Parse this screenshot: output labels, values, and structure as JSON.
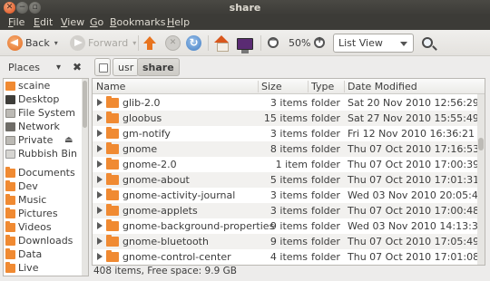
{
  "window": {
    "title": "share"
  },
  "menubar": {
    "items": [
      {
        "pre": "",
        "key": "F",
        "post": "ile"
      },
      {
        "pre": "",
        "key": "E",
        "post": "dit"
      },
      {
        "pre": "",
        "key": "V",
        "post": "iew"
      },
      {
        "pre": "",
        "key": "G",
        "post": "o"
      },
      {
        "pre": "",
        "key": "B",
        "post": "ookmarks"
      },
      {
        "pre": "",
        "key": "H",
        "post": "elp"
      }
    ]
  },
  "toolbar": {
    "back_label": "Back",
    "forward_label": "Forward",
    "zoom_level": "50%",
    "view_mode": "List View"
  },
  "location": {
    "places_label": "Places",
    "breadcrumbs": [
      "usr",
      "share"
    ]
  },
  "sidebar": {
    "items": [
      {
        "label": "scaine",
        "icon": "home-folder-icon",
        "kind": "home"
      },
      {
        "label": "Desktop",
        "icon": "desktop-icon",
        "kind": "desktop"
      },
      {
        "label": "File System",
        "icon": "drive-icon",
        "kind": "drive"
      },
      {
        "label": "Network",
        "icon": "network-icon",
        "kind": "network"
      },
      {
        "label": "Private",
        "icon": "drive-icon",
        "kind": "drive",
        "eject": true
      },
      {
        "label": "Rubbish Bin",
        "icon": "trash-icon",
        "kind": "trash"
      },
      {
        "label": "Documents",
        "icon": "folder-icon",
        "kind": "folder"
      },
      {
        "label": "Dev",
        "icon": "folder-icon",
        "kind": "folder"
      },
      {
        "label": "Music",
        "icon": "folder-icon",
        "kind": "folder"
      },
      {
        "label": "Pictures",
        "icon": "folder-icon",
        "kind": "folder"
      },
      {
        "label": "Videos",
        "icon": "folder-icon",
        "kind": "folder"
      },
      {
        "label": "Downloads",
        "icon": "folder-icon",
        "kind": "folder"
      },
      {
        "label": "Data",
        "icon": "folder-icon",
        "kind": "folder"
      },
      {
        "label": "Live",
        "icon": "folder-icon",
        "kind": "folder"
      }
    ]
  },
  "filelist": {
    "columns": {
      "name": "Name",
      "size": "Size",
      "type": "Type",
      "date": "Date Modified"
    },
    "rows": [
      {
        "name": "glib-2.0",
        "size": "3 items",
        "type": "folder",
        "date": "Sat 20 Nov 2010 12:56:29 GMT"
      },
      {
        "name": "gloobus",
        "size": "15 items",
        "type": "folder",
        "date": "Sat 27 Nov 2010 15:55:49 GMT"
      },
      {
        "name": "gm-notify",
        "size": "3 items",
        "type": "folder",
        "date": "Fri 12 Nov 2010 16:36:21 GMT"
      },
      {
        "name": "gnome",
        "size": "8 items",
        "type": "folder",
        "date": "Thu 07 Oct 2010 17:16:53 BST"
      },
      {
        "name": "gnome-2.0",
        "size": "1 item",
        "type": "folder",
        "date": "Thu 07 Oct 2010 17:00:39 BST"
      },
      {
        "name": "gnome-about",
        "size": "5 items",
        "type": "folder",
        "date": "Thu 07 Oct 2010 17:01:31 BST"
      },
      {
        "name": "gnome-activity-journal",
        "size": "3 items",
        "type": "folder",
        "date": "Wed 03 Nov 2010 20:05:46 GMT"
      },
      {
        "name": "gnome-applets",
        "size": "3 items",
        "type": "folder",
        "date": "Thu 07 Oct 2010 17:00:48 BST"
      },
      {
        "name": "gnome-background-properties",
        "size": "9 items",
        "type": "folder",
        "date": "Wed 03 Nov 2010 14:13:34 GMT"
      },
      {
        "name": "gnome-bluetooth",
        "size": "9 items",
        "type": "folder",
        "date": "Thu 07 Oct 2010 17:05:49 BST"
      },
      {
        "name": "gnome-control-center",
        "size": "4 items",
        "type": "folder",
        "date": "Thu 07 Oct 2010 17:01:08 BST"
      }
    ]
  },
  "status": {
    "text": "408 items, Free space: 9.9 GB"
  }
}
